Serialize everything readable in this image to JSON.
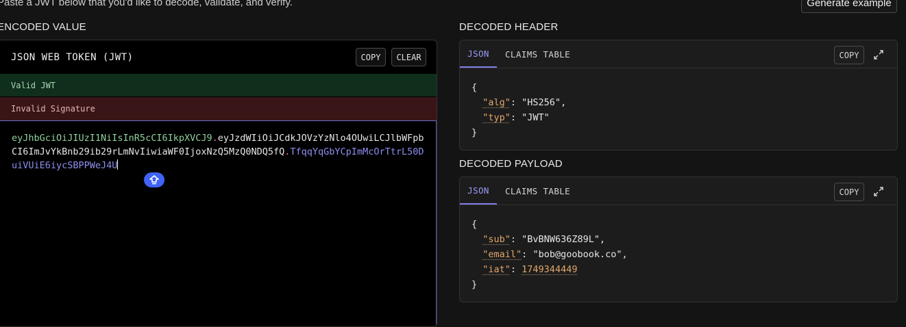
{
  "intro": {
    "text": "Paste a JWT below that you'd like to decode, validate, and verify."
  },
  "generate_button": {
    "label": "Generate example"
  },
  "encoded": {
    "section_title": "ENCODED VALUE",
    "panel_title": "JSON WEB TOKEN (JWT)",
    "copy_label": "COPY",
    "clear_label": "CLEAR",
    "status_valid": "Valid JWT",
    "status_invalid": "Invalid Signature",
    "token": {
      "header": "eyJhbGciOiJIUzI1NiIsInR5cCI6IkpXVCJ9",
      "payload": "eyJzdWIiOiJCdkJOVzYzNlo4OUwiLCJlbWFpbCI6ImJvYkBnb29ib29rLmNvIiwiaWF0IjoxNzQ5MzQ0NDQ5fQ",
      "signature": "TfqqYqGbYCpImMcOrTtrL50DuiVUiE6iycSBPPWeJ4U",
      "dot": "."
    }
  },
  "decoded_header": {
    "section_title": "DECODED HEADER",
    "tab_json": "JSON",
    "tab_claims": "CLAIMS TABLE",
    "copy_label": "COPY",
    "open_brace": "{",
    "close_brace": "}",
    "fields": [
      {
        "key": "\"alg\"",
        "value": "\"HS256\"",
        "sep": ": ",
        "comma": ","
      },
      {
        "key": "\"typ\"",
        "value": "\"JWT\"",
        "sep": ": ",
        "comma": ""
      }
    ]
  },
  "decoded_payload": {
    "section_title": "DECODED PAYLOAD",
    "tab_json": "JSON",
    "tab_claims": "CLAIMS TABLE",
    "copy_label": "COPY",
    "open_brace": "{",
    "close_brace": "}",
    "fields": [
      {
        "key": "\"sub\"",
        "value": "\"BvBNW636Z89L\"",
        "sep": ": ",
        "comma": ","
      },
      {
        "key": "\"email\"",
        "value": "\"bob@goobook.co\"",
        "sep": ": ",
        "comma": ","
      },
      {
        "key": "\"iat\"",
        "value": "1749344449",
        "sep": ": ",
        "comma": ""
      }
    ]
  },
  "colors": {
    "accent": "#7f7fe6",
    "valid_bg": "#0f2e1c",
    "invalid_bg": "#3a1518",
    "key": "#e3a76a"
  },
  "icons": {
    "floating": "shield-upload-icon",
    "expand": "expand-icon"
  }
}
